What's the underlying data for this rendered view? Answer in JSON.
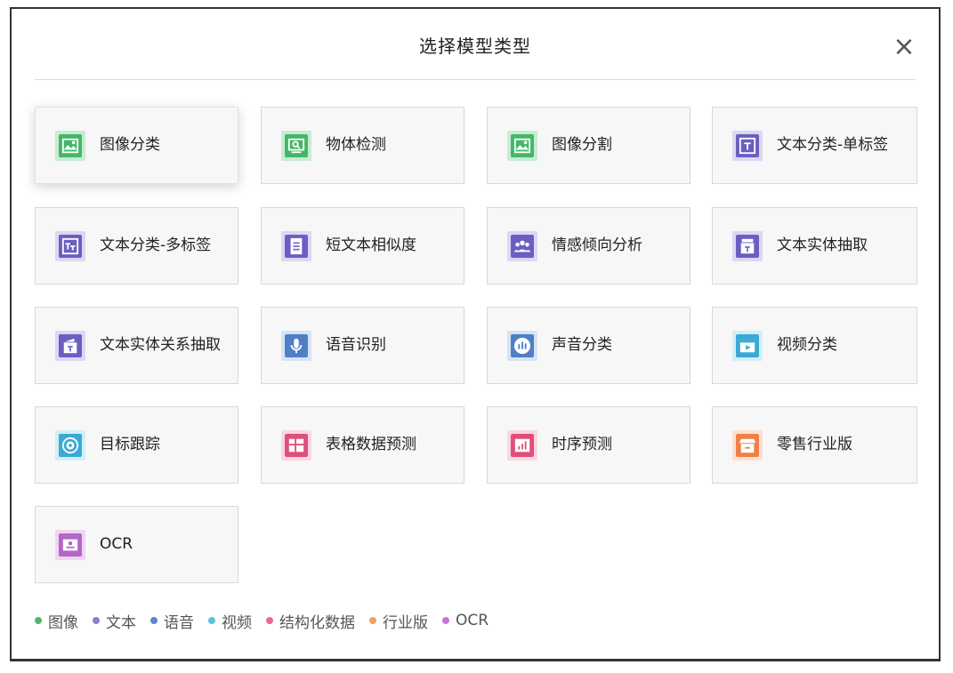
{
  "dialog": {
    "title": "选择模型类型",
    "close": "×"
  },
  "colors": {
    "image": "#4cb86a",
    "text": "#8b7dd8",
    "voice": "#5a86c8",
    "video": "#5bc1e0",
    "structured": "#e96a8a",
    "industry": "#f2a06c",
    "ocr": "#c27ad0"
  },
  "cards": [
    {
      "label": "图像分类",
      "icon": "image-icon",
      "category": "image",
      "selected": true
    },
    {
      "label": "物体检测",
      "icon": "detect-icon",
      "category": "image"
    },
    {
      "label": "图像分割",
      "icon": "image-icon",
      "category": "image"
    },
    {
      "label": "文本分类-单标签",
      "icon": "text-t-icon",
      "category": "text"
    },
    {
      "label": "文本分类-多标签",
      "icon": "text-tt-icon",
      "category": "text"
    },
    {
      "label": "短文本相似度",
      "icon": "doc-icon",
      "category": "text"
    },
    {
      "label": "情感倾向分析",
      "icon": "people-icon",
      "category": "text"
    },
    {
      "label": "文本实体抽取",
      "icon": "entity-icon",
      "category": "text"
    },
    {
      "label": "文本实体关系抽取",
      "icon": "relation-icon",
      "category": "text"
    },
    {
      "label": "语音识别",
      "icon": "microphone-icon",
      "category": "voice"
    },
    {
      "label": "声音分类",
      "icon": "sound-bars-icon",
      "category": "voice"
    },
    {
      "label": "视频分类",
      "icon": "video-icon",
      "category": "video"
    },
    {
      "label": "目标跟踪",
      "icon": "target-icon",
      "category": "video"
    },
    {
      "label": "表格数据预测",
      "icon": "table-icon",
      "category": "structured"
    },
    {
      "label": "时序预测",
      "icon": "chart-icon",
      "category": "structured"
    },
    {
      "label": "零售行业版",
      "icon": "store-icon",
      "category": "industry"
    },
    {
      "label": "OCR",
      "icon": "id-card-icon",
      "category": "ocr"
    }
  ],
  "legend": [
    {
      "label": "图像",
      "category": "image"
    },
    {
      "label": "文本",
      "category": "text"
    },
    {
      "label": "语音",
      "category": "voice"
    },
    {
      "label": "视频",
      "category": "video"
    },
    {
      "label": "结构化数据",
      "category": "structured"
    },
    {
      "label": "行业版",
      "category": "industry"
    },
    {
      "label": "OCR",
      "category": "ocr"
    }
  ]
}
